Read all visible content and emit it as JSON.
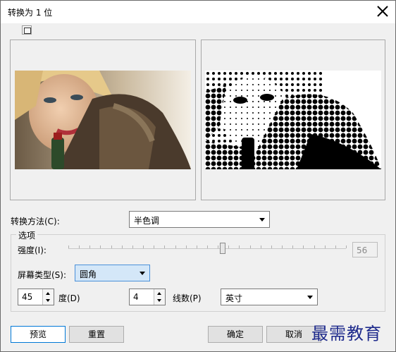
{
  "window": {
    "title": "转换为 1 位"
  },
  "icons": {
    "close": "close-icon",
    "preview_toggle": "split-preview-icon"
  },
  "conversion": {
    "label": "转换方法(C):",
    "value": "半色调"
  },
  "options": {
    "group_title": "选项",
    "intensity": {
      "label": "强度(I):",
      "value": "56",
      "level": 56
    },
    "screen_type": {
      "label": "屏幕类型(S):",
      "value": "圆角"
    },
    "angle": {
      "value": "45",
      "label": "度(D)"
    },
    "lines": {
      "value": "4",
      "label": "线数(P)"
    },
    "unit": {
      "value": "英寸"
    }
  },
  "buttons": {
    "preview": "预览",
    "reset": "重置",
    "ok": "确定",
    "cancel": "取消"
  },
  "watermark": "最需教育",
  "colors": {
    "focus_blue": "#d4e7f8",
    "default_border": "#0078d7",
    "watermark": "#1e2a8c"
  }
}
